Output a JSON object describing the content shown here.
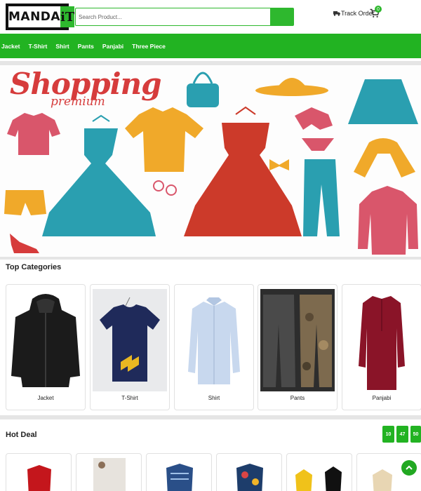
{
  "header": {
    "logo_main": "MANDA",
    "logo_accent": "iT",
    "search_placeholder": "Search Product...",
    "track_order": "Track Order",
    "cart_count": "0"
  },
  "nav": {
    "items": [
      "Jacket",
      "T-Shirt",
      "Shirt",
      "Pants",
      "Panjabi",
      "Three Piece"
    ]
  },
  "banner": {
    "title": "Shopping",
    "subtitle": "premium"
  },
  "top_categories": {
    "title": "Top Categories",
    "items": [
      {
        "label": "Jacket",
        "icon": "jacket-image"
      },
      {
        "label": "T-Shirt",
        "icon": "tshirt-image"
      },
      {
        "label": "Shirt",
        "icon": "shirt-image"
      },
      {
        "label": "Pants",
        "icon": "pants-image"
      },
      {
        "label": "Panjabi",
        "icon": "panjabi-image"
      }
    ]
  },
  "hot_deal": {
    "title": "Hot Deal",
    "timer": [
      "10",
      "47",
      "50"
    ]
  },
  "colors": {
    "brand_green": "#22b322",
    "banner_red": "#d63c3c",
    "banner_teal": "#2a9fb0",
    "banner_yellow": "#f0a92a",
    "banner_pink": "#d9566b"
  }
}
